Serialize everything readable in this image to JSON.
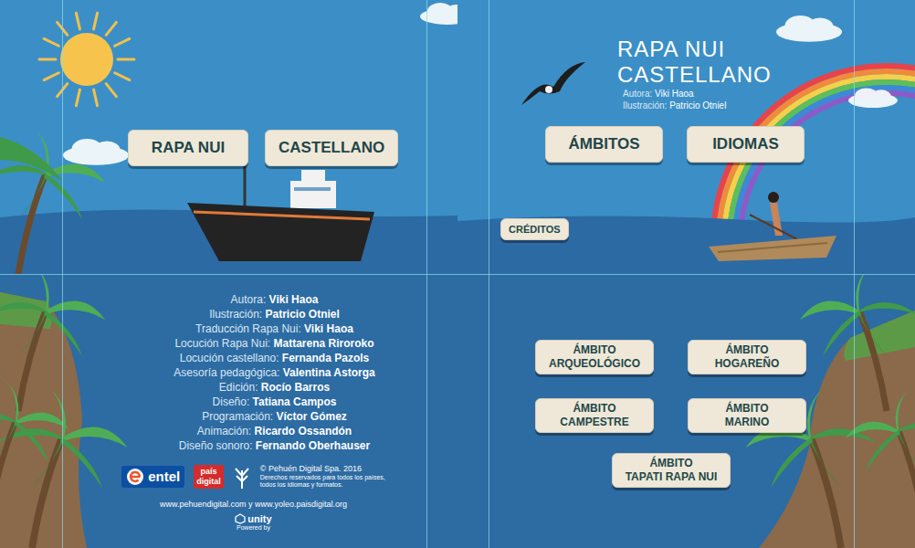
{
  "screens": {
    "language_select": {
      "buttons": [
        {
          "label": "RAPA NUI"
        },
        {
          "label": "CASTELLANO"
        }
      ]
    },
    "home": {
      "title": [
        "RAPA NUI",
        "CASTELLANO"
      ],
      "authors": [
        {
          "role": "Autora:",
          "name": "Viki Haoa"
        },
        {
          "role": "Ilustración:",
          "name": "Patricio Otniel"
        }
      ],
      "buttons": [
        {
          "label": "ÁMBITOS"
        },
        {
          "label": "IDIOMAS"
        }
      ],
      "credits_button": "CRÉDITOS"
    },
    "credits": {
      "entries": [
        {
          "role": "Autora:",
          "name": "Viki Haoa"
        },
        {
          "role": "Ilustración:",
          "name": "Patricio Otniel"
        },
        {
          "role": "Traducción Rapa Nui:",
          "name": "Viki Haoa"
        },
        {
          "role": "Locución Rapa Nui:",
          "name": "Mattarena Riroroko"
        },
        {
          "role": "Locución castellano:",
          "name": "Fernanda Pazols"
        },
        {
          "role": "Asesoría pedagógica:",
          "name": "Valentina Astorga"
        },
        {
          "role": "Edición:",
          "name": "Rocío Barros"
        },
        {
          "role": "Diseño:",
          "name": "Tatiana Campos"
        },
        {
          "role": "Programación:",
          "name": "Víctor Gómez"
        },
        {
          "role": "Animación:",
          "name": "Ricardo Ossandón"
        },
        {
          "role": "Diseño sonoro:",
          "name": "Fernando Oberhauser"
        }
      ],
      "sponsors": {
        "entel": "entel",
        "pais": [
          "país",
          "digital"
        ]
      },
      "copyright": "© Pehuén Digital Spa. 2016",
      "rights": [
        "Derechos reservados para todos los países,",
        "todos los idiomas y formatos."
      ],
      "urls": "www.pehuendigital.com y www.yoleo.paisdigital.org",
      "engine": {
        "name": "unity",
        "caption": "Powered by"
      }
    },
    "ambitos": {
      "buttons": [
        {
          "lines": [
            "ÁMBITO",
            "ARQUEOLÓGICO"
          ]
        },
        {
          "lines": [
            "ÁMBITO",
            "HOGAREÑO"
          ]
        },
        {
          "lines": [
            "ÁMBITO",
            "CAMPESTRE"
          ]
        },
        {
          "lines": [
            "ÁMBITO",
            "MARINO"
          ]
        },
        {
          "lines": [
            "ÁMBITO",
            "TAPATI RAPA NUI"
          ]
        }
      ]
    }
  }
}
